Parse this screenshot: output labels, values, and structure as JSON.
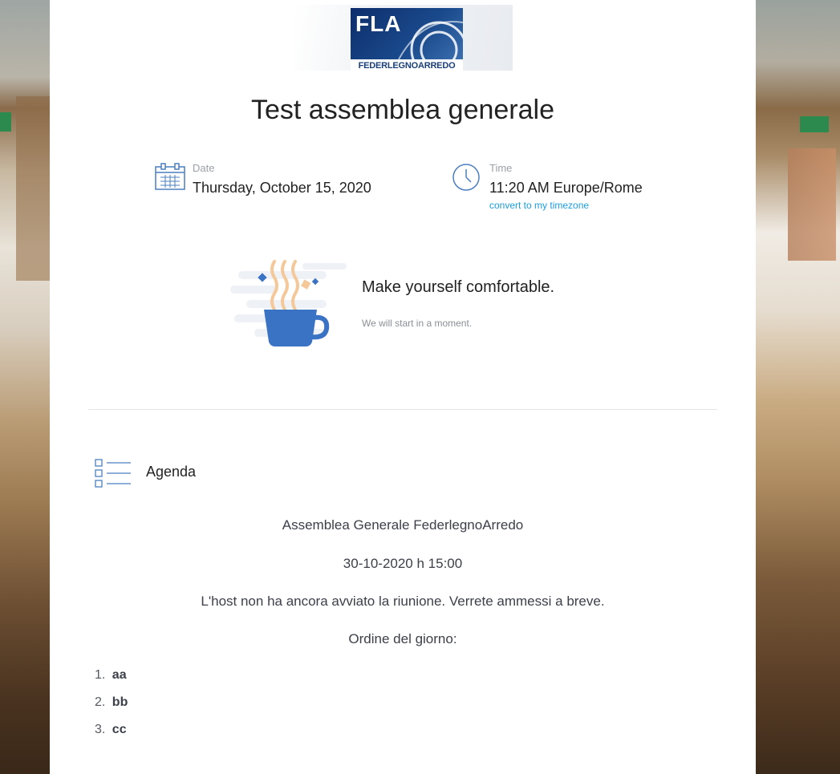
{
  "logo": {
    "main_text": "FLA",
    "sub_text": "FEDERLEGNOARREDO"
  },
  "event": {
    "title": "Test assemblea generale",
    "date_label": "Date",
    "date_value": "Thursday, October 15, 2020",
    "time_label": "Time",
    "time_value": "11:20 AM Europe/Rome",
    "timezone_link": "convert to my timezone"
  },
  "waiting": {
    "title": "Make yourself comfortable.",
    "subtitle": "We will start in a moment."
  },
  "agenda": {
    "label": "Agenda",
    "lines": [
      "Assemblea Generale FederlegnoArredo",
      "30-10-2020 h 15:00",
      "L'host non ha ancora avviato la riunione. Verrete ammessi a breve.",
      "Ordine del giorno:"
    ],
    "items": [
      {
        "num": "1.",
        "text": "aa"
      },
      {
        "num": "2.",
        "text": "bb"
      },
      {
        "num": "3.",
        "text": "cc"
      }
    ]
  },
  "colors": {
    "accent": "#4a7fc1",
    "link": "#1a9ee0",
    "cup": "#3a72c4",
    "steam": "#f5c89a"
  }
}
